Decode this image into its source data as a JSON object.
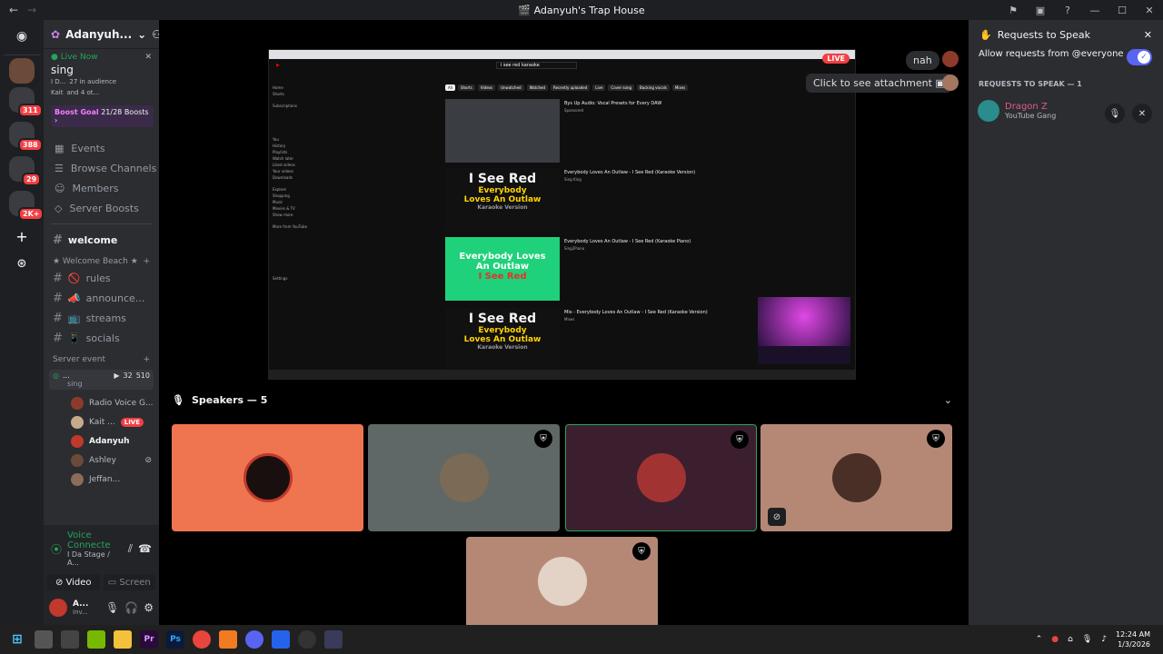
{
  "window": {
    "title": "Adanyuh's Trap House"
  },
  "server": {
    "name": "Adanyuh..."
  },
  "live": {
    "label": "Live Now",
    "title": "sing",
    "meta_host": "I D...",
    "meta_audience": "27 in audience",
    "meta_people": "Kait",
    "meta_more": "and 4 ot..."
  },
  "boost": {
    "label": "Boost Goal",
    "value": "21/28 Boosts"
  },
  "nav": [
    {
      "icon": "calendar-icon",
      "label": "Events"
    },
    {
      "icon": "browse-icon",
      "label": "Browse Channels"
    },
    {
      "icon": "members-icon",
      "label": "Members"
    },
    {
      "icon": "boost-icon",
      "label": "Server Boosts"
    }
  ],
  "welcome_channel": "welcome",
  "category_beach": "★ Welcome Beach ★",
  "channels": [
    {
      "emoji": "🚫",
      "label": "rules"
    },
    {
      "emoji": "📣",
      "label": "announce..."
    },
    {
      "emoji": "📺",
      "label": "streams"
    },
    {
      "emoji": "📱",
      "label": "socials"
    }
  ],
  "category_event": "Server event",
  "voice_channel": {
    "name": "...",
    "subtitle": "sing",
    "video_count": "32",
    "listeners": "510"
  },
  "voice_users": [
    {
      "name": "Radio Voice G...",
      "color": "#8e3a2b"
    },
    {
      "name": "Kait ...",
      "color": "#c7a98b",
      "live": "LIVE"
    },
    {
      "name": "Adanyuh",
      "color": "#c0392b"
    },
    {
      "name": "Ashley",
      "color": "#6b4a3a"
    },
    {
      "name": "Jeffan...",
      "color": "#8b6b5a"
    }
  ],
  "voice_connected": {
    "title": "Voice Connecte",
    "subtitle": "I Da Stage / A..."
  },
  "voice_buttons": {
    "video": "Video",
    "screen": "Screen"
  },
  "user": {
    "name": "A...",
    "status": "Inv..."
  },
  "server_badges": [
    "311",
    "388",
    "29",
    "2K+"
  ],
  "stream": {
    "live_label": "LIVE",
    "search": "i see red karaoke",
    "chips": [
      "All",
      "Shorts",
      "Videos",
      "Unwatched",
      "Watched",
      "Recently uploaded",
      "Live",
      "Cover song",
      "Backing vocals",
      "Mixes"
    ],
    "sidebar": [
      "Home",
      "Shorts",
      "Subscriptions",
      "You",
      "History",
      "Playlists",
      "Watch later",
      "Liked videos",
      "Your videos",
      "Downloads",
      "Explore",
      "Shopping",
      "Music",
      "Movies & TV",
      "Show more",
      "More from YouTube",
      "Settings"
    ],
    "videos": [
      {
        "title": "Bys Up Audio: Vocal Presets for Every DAW",
        "sub": "Sponsored"
      },
      {
        "title": "Everybody Loves An Outlaw - I See Red (Karaoke Version)",
        "sub": "Sing King"
      },
      {
        "title": "Everybody Loves An Outlaw - I See Red (Karaoke Piano)",
        "sub": "Sing2Piano"
      },
      {
        "title": "Mix - Everybody Loves An Outlaw - I See Red (Karaoke Version)",
        "sub": "Mixes"
      }
    ],
    "thumb": {
      "big": "I See Red",
      "mid1": "Everybody",
      "mid2": "Loves An Outlaw",
      "small": "Karaoke Version",
      "green_big": "Everybody Loves An Outlaw",
      "green_red": "I See Red"
    }
  },
  "chat_bubbles": {
    "nah": "nah",
    "attachment": "Click to see attachment"
  },
  "speakers": {
    "title": "Speakers — 5"
  },
  "tiles": [
    {
      "bg": "#ef7550",
      "avatar": "#1a0f0f",
      "shield": false,
      "mute": false
    },
    {
      "bg": "#5f6866",
      "avatar": "#7b6a55",
      "shield": true,
      "mute": false
    },
    {
      "bg": "#3b1f2f",
      "avatar": "#a23333",
      "shield": true,
      "mute": false
    },
    {
      "bg": "#b58876",
      "avatar": "#4a2f26",
      "shield": true,
      "mute": true
    },
    {
      "bg": "#b58876",
      "avatar": "#e3d3c6",
      "shield": true,
      "mute": false
    }
  ],
  "panel": {
    "title": "Requests to Speak",
    "allow": "Allow requests from @everyone",
    "section": "REQUESTS TO SPEAK — 1",
    "requester_name": "Dragon",
    "requester_suffix": "Z",
    "requester_sub": "YouTube Gang"
  },
  "clock": {
    "time": "12:24 AM",
    "date": "1/3/2026"
  },
  "colors": {
    "accent": "#5865f2",
    "live": "#f23f43",
    "online": "#23a55a"
  }
}
